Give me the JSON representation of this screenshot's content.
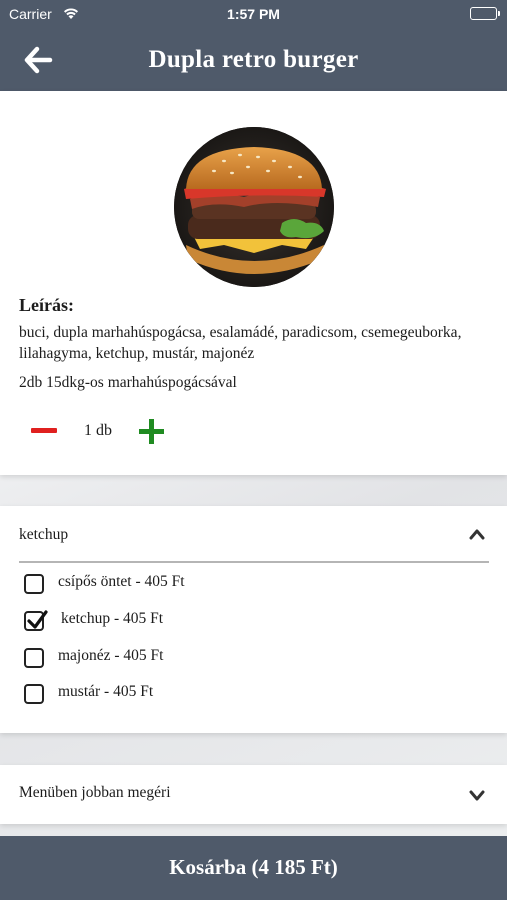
{
  "status_bar": {
    "carrier": "Carrier",
    "time": "1:57 PM"
  },
  "header": {
    "title": "Dupla retro burger",
    "back_icon": "arrow-left-icon"
  },
  "product": {
    "image_icon": "burger-photo",
    "description_heading": "Leírás:",
    "description": "buci, dupla marhahúspogácsa, esalamádé, paradicsom, csemegeuborka, lilahagyma, ketchup, mustár, majonéz",
    "extra": "2db 15dkg-os marhahúspogácsával",
    "quantity": "1 db",
    "colors": {
      "minus": "#e0201f",
      "plus": "#1f8b21"
    }
  },
  "sauce_section": {
    "title": "ketchup",
    "expanded": true,
    "options": [
      {
        "label": "csípős öntet - 405 Ft",
        "checked": false
      },
      {
        "label": "ketchup - 405 Ft",
        "checked": true
      },
      {
        "label": "majonéz - 405 Ft",
        "checked": false
      },
      {
        "label": "mustár - 405 Ft",
        "checked": false
      }
    ]
  },
  "menu_section": {
    "title": "Menüben jobban megéri",
    "expanded": false
  },
  "cart": {
    "label": "Kosárba (4 185 Ft)"
  },
  "theme": {
    "bar_color": "#4f5a6a"
  }
}
